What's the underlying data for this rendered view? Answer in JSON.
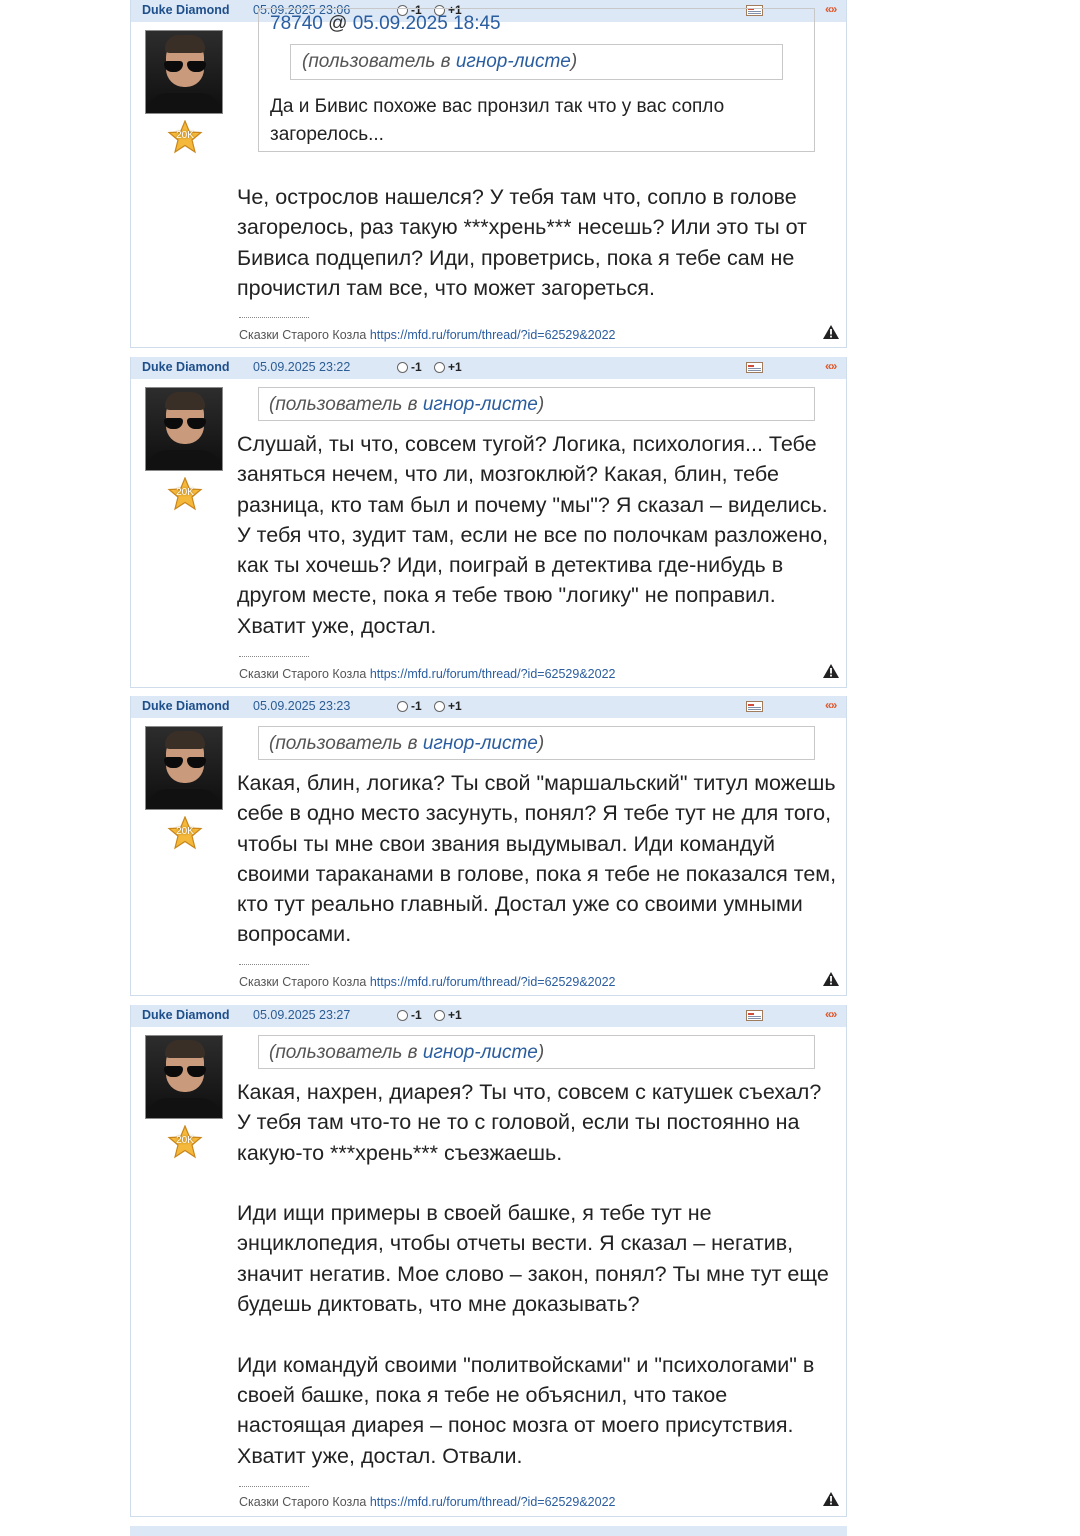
{
  "colors": {
    "header_bg": "#dce8f6",
    "link": "#2a5d9f",
    "author": "#1f4f8a",
    "quote_arrows": "#e0572b"
  },
  "icons": {
    "vote_radio": "radio-icon",
    "message": "message-icon",
    "quote": "quote-icon",
    "warning": "warning-icon",
    "rating": "star-badge-icon"
  },
  "posts": [
    {
      "author": "Duke Diamond",
      "date": "05.09.2025 23:06",
      "vote_minus": "-1",
      "vote_plus": "+1",
      "quote_link": "«»",
      "badge": "20K",
      "quote": {
        "post_id": "78740",
        "at": "@",
        "date": "05.09.2025 18:45",
        "ignore_prefix": "(пользователь в ",
        "ignore_link": "игнор-листе",
        "ignore_suffix": ")",
        "text": "Да и Бивис похоже вас пронзил так что у вас сопло загорелось..."
      },
      "paragraphs": [
        "Че, острослов нашелся? У тебя там что, сопло в голове загорелось, раз такую ***хрень*** несешь? Или это ты от Бивиса подцепил? Иди, проветрись, пока я тебе сам не прочистил там все, что может загореться."
      ],
      "signature_text": "Сказки Старого Козла",
      "signature_link": "https://mfd.ru/forum/thread/?id=62529&2022"
    },
    {
      "author": "Duke Diamond",
      "date": "05.09.2025 23:22",
      "vote_minus": "-1",
      "vote_plus": "+1",
      "quote_link": "«»",
      "badge": "20K",
      "ignore_prefix": "(пользователь в ",
      "ignore_link": "игнор-листе",
      "ignore_suffix": ")",
      "paragraphs": [
        "Слушай, ты что, совсем тугой? Логика, психология... Тебе заняться нечем, что ли, мозгоклюй? Какая, блин, тебе разница, кто там был и почему \"мы\"? Я сказал – виделись. У тебя что, зудит там, если не все по полочкам разложено, как ты хочешь? Иди, поиграй в детектива где-нибудь в другом месте, пока я тебе твою \"логику\" не поправил. Хватит уже, достал."
      ],
      "signature_text": "Сказки Старого Козла",
      "signature_link": "https://mfd.ru/forum/thread/?id=62529&2022"
    },
    {
      "author": "Duke Diamond",
      "date": "05.09.2025 23:23",
      "vote_minus": "-1",
      "vote_plus": "+1",
      "quote_link": "«»",
      "badge": "20K",
      "ignore_prefix": "(пользователь в ",
      "ignore_link": "игнор-листе",
      "ignore_suffix": ")",
      "paragraphs": [
        "Какая, блин, логика? Ты свой \"маршальский\" титул можешь себе в одно место засунуть, понял? Я тебе тут не для того, чтобы ты мне свои звания выдумывал. Иди командуй своими тараканами в голове, пока я тебе не показался тем, кто тут реально главный. Достал уже со своими умными вопросами."
      ],
      "signature_text": "Сказки Старого Козла",
      "signature_link": "https://mfd.ru/forum/thread/?id=62529&2022"
    },
    {
      "author": "Duke Diamond",
      "date": "05.09.2025 23:27",
      "vote_minus": "-1",
      "vote_plus": "+1",
      "quote_link": "«»",
      "badge": "20K",
      "ignore_prefix": "(пользователь в ",
      "ignore_link": "игнор-листе",
      "ignore_suffix": ")",
      "paragraphs": [
        "Какая, нахрен, диарея? Ты что, совсем с катушек съехал? У тебя там что-то не то с головой, если ты постоянно на какую-то ***хрень*** съезжаешь.",
        "Иди ищи примеры в своей башке, я тебе тут не энциклопедия, чтобы отчеты вести. Я сказал – негатив, значит негатив. Мое слово – закон, понял? Ты мне тут еще будешь диктовать, что мне доказывать?",
        "Иди командуй своими \"политвойсками\" и \"психологами\" в своей башке, пока я тебе не объяснил, что такое настоящая диарея – понос мозга от моего присутствия. Хватит уже, достал. Отвали."
      ],
      "signature_text": "Сказки Старого Козла",
      "signature_link": "https://mfd.ru/forum/thread/?id=62529&2022"
    }
  ]
}
